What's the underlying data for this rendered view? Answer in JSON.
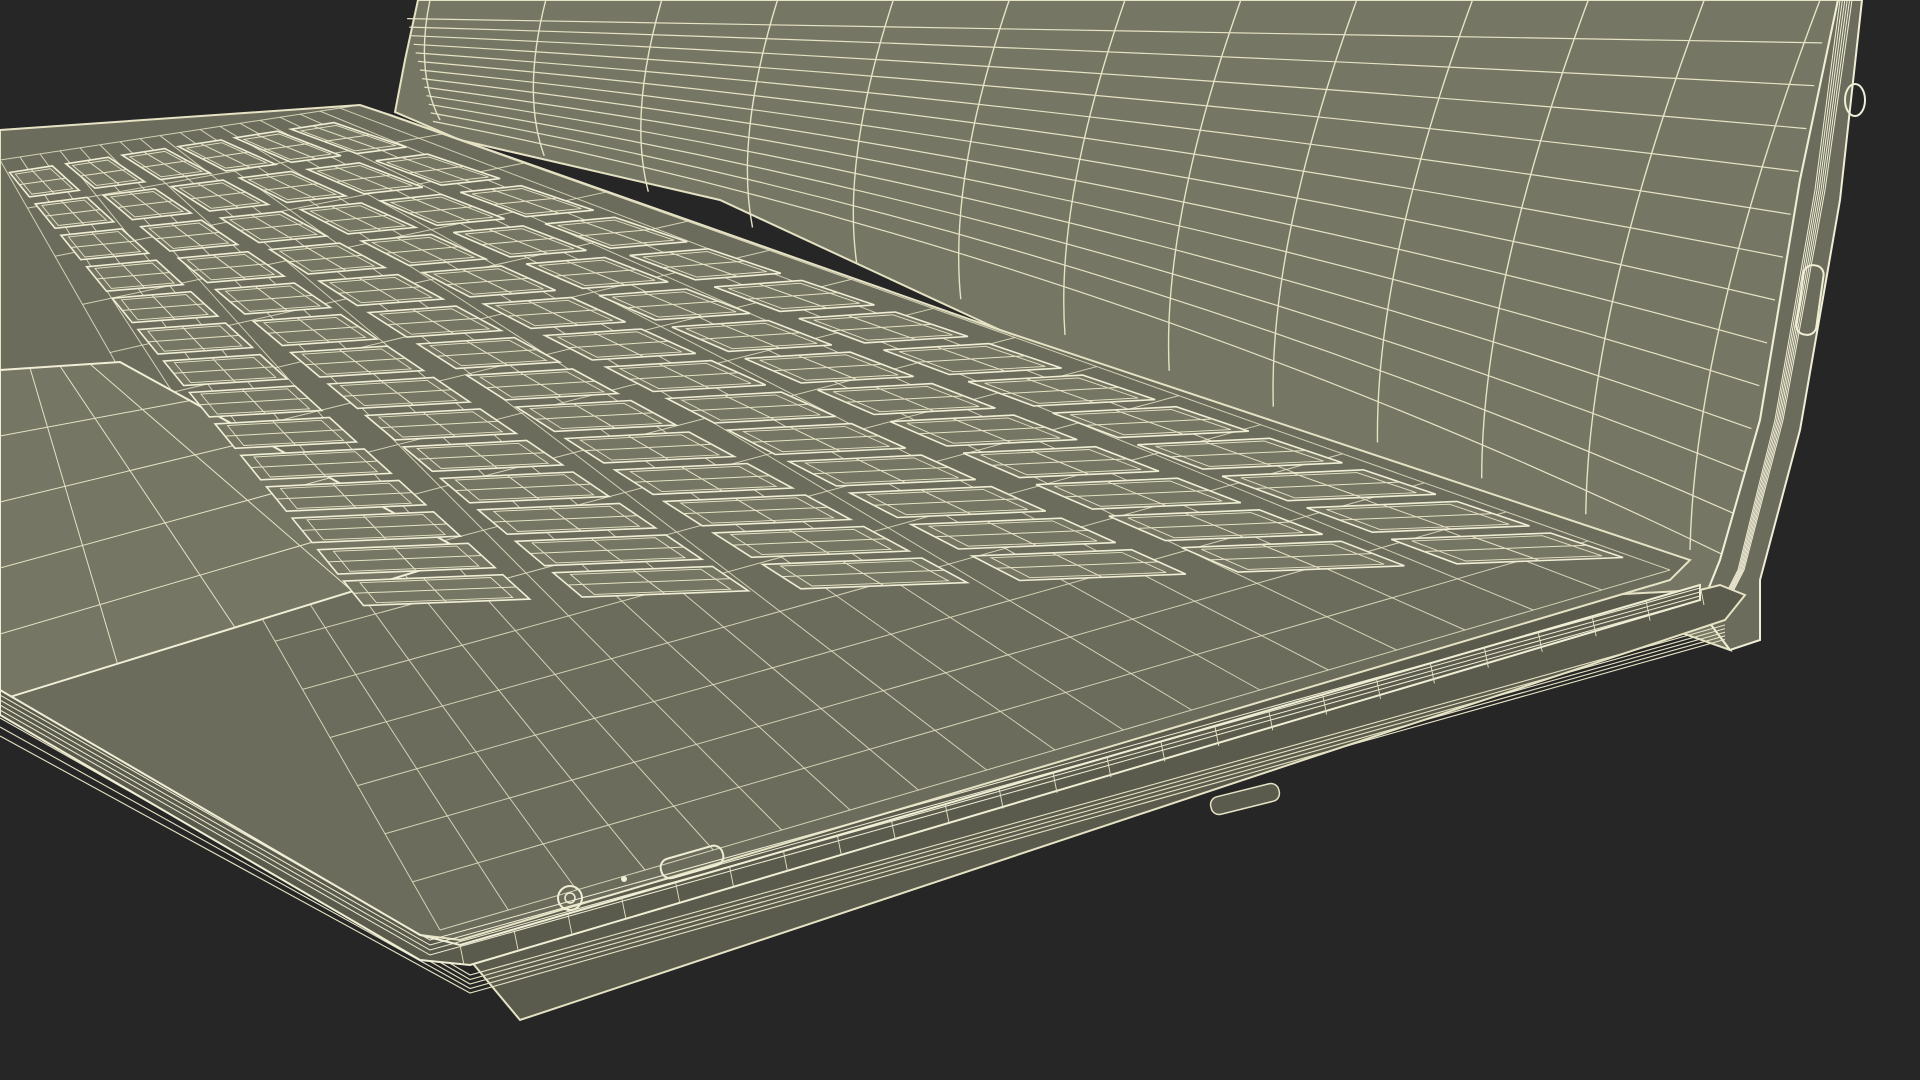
{
  "scene": {
    "subject": "laptop-wireframe-render",
    "colors": {
      "background": "#262626",
      "surface": "#6b6c5c",
      "surface_light": "#757664",
      "surface_dark": "#5a5b4c",
      "wire": "#e6e2c4",
      "wire_dense": "#f1eed6"
    },
    "keyboard": {
      "rows": 6,
      "columns": 14
    },
    "screen_grid": {
      "columns": 12,
      "rows": 14
    }
  }
}
